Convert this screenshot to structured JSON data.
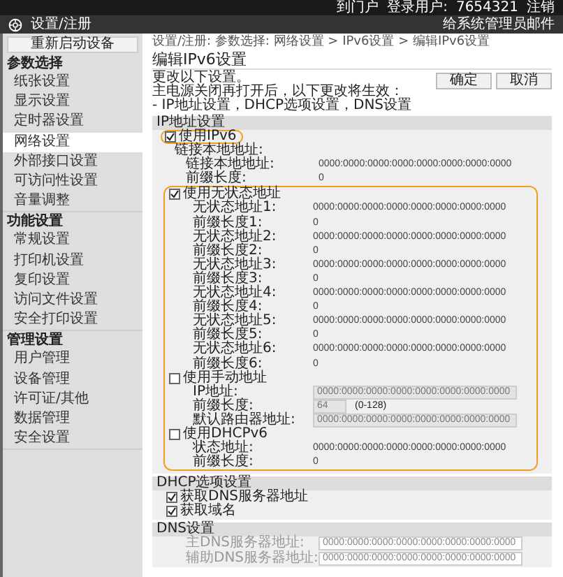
{
  "top_bar": {
    "portal_link": "到门户",
    "user_label": "登录用户:",
    "user_id": "7654321",
    "logout_link": "注销"
  },
  "title_bar": {
    "title": "设置/注册",
    "mail_link": "给系统管理员邮件"
  },
  "sidebar": {
    "restart_button": "重新启动设备",
    "groups": [
      {
        "heading": "参数选择",
        "items": [
          {
            "label": "纸张设置",
            "selected": false
          },
          {
            "label": "显示设置",
            "selected": false
          },
          {
            "label": "定时器设置",
            "selected": false
          },
          {
            "label": "网络设置",
            "selected": true
          },
          {
            "label": "外部接口设置",
            "selected": false
          },
          {
            "label": "可访问性设置",
            "selected": false
          },
          {
            "label": "音量调整",
            "selected": false
          }
        ]
      },
      {
        "heading": "功能设置",
        "items": [
          {
            "label": "常规设置",
            "selected": false
          },
          {
            "label": "打印机设置",
            "selected": false
          },
          {
            "label": "复印设置",
            "selected": false
          },
          {
            "label": "访问文件设置",
            "selected": false
          },
          {
            "label": "安全打印设置",
            "selected": false
          }
        ]
      },
      {
        "heading": "管理设置",
        "items": [
          {
            "label": "用户管理",
            "selected": false
          },
          {
            "label": "设备管理",
            "selected": false
          },
          {
            "label": "许可证/其他",
            "selected": false
          },
          {
            "label": "数据管理",
            "selected": false
          },
          {
            "label": "安全设置",
            "selected": false
          }
        ]
      }
    ]
  },
  "main": {
    "breadcrumb": "设置/注册: 参数选择: 网络设置 > IPv6设置 > 编辑IPv6设置",
    "title": "编辑IPv6设置",
    "notes": [
      "更改以下设置。",
      "主电源关闭再打开后，以下更改将生效：",
      "- IP地址设置，DHCP选项设置，DNS设置"
    ],
    "buttons": [
      "确定",
      "取消"
    ],
    "sections": [
      {
        "heading": "IP地址设置",
        "rows": [
          {
            "kind": "checkbox",
            "label": "使用IPv6",
            "checked": true,
            "highlighted": true
          },
          {
            "kind": "label",
            "label": "链接本地地址:"
          },
          {
            "kind": "value",
            "label": "链接本地地址:",
            "value": "0000:0000:0000:0000:0000:0000:0000:0000"
          },
          {
            "kind": "value",
            "label": "前缀长度:",
            "value": "0"
          },
          {
            "kind": "frame",
            "highlighted": true,
            "rows": [
              {
                "kind": "checkbox",
                "label": "使用无状态地址",
                "checked": true
              },
              {
                "kind": "value",
                "label": "无状态地址1:",
                "value": "0000:0000:0000:0000:0000:0000:0000:0000"
              },
              {
                "kind": "value",
                "label": "前缀长度1:",
                "value": "0"
              },
              {
                "kind": "value",
                "label": "无状态地址2:",
                "value": "0000:0000:0000:0000:0000:0000:0000:0000"
              },
              {
                "kind": "value",
                "label": "前缀长度2:",
                "value": "0"
              },
              {
                "kind": "value",
                "label": "无状态地址3:",
                "value": "0000:0000:0000:0000:0000:0000:0000:0000"
              },
              {
                "kind": "value",
                "label": "前缀长度3:",
                "value": "0"
              },
              {
                "kind": "value",
                "label": "无状态地址4:",
                "value": "0000:0000:0000:0000:0000:0000:0000:0000"
              },
              {
                "kind": "value",
                "label": "前缀长度4:",
                "value": "0"
              },
              {
                "kind": "value",
                "label": "无状态地址5:",
                "value": "0000:0000:0000:0000:0000:0000:0000:0000"
              },
              {
                "kind": "value",
                "label": "前缀长度5:",
                "value": "0"
              },
              {
                "kind": "value",
                "label": "无状态地址6:",
                "value": "0000:0000:0000:0000:0000:0000:0000:0000"
              },
              {
                "kind": "value",
                "label": "前缀长度6:",
                "value": "0"
              },
              {
                "kind": "checkbox",
                "label": "使用手动地址",
                "checked": false
              },
              {
                "kind": "field",
                "label": "IP地址:",
                "value": "0000:0000:0000:0000:0000:0000:0000:0000",
                "disabled": true
              },
              {
                "kind": "field",
                "label": "前缀长度:",
                "value": "64",
                "hint": "(0-128)",
                "disabled": true,
                "short": true
              },
              {
                "kind": "field",
                "label": "默认路由器地址:",
                "value": "0000:0000:0000:0000:0000:0000:0000:0000",
                "disabled": true
              },
              {
                "kind": "checkbox",
                "label": "使用DHCPv6",
                "checked": false
              },
              {
                "kind": "value",
                "label": "状态地址:",
                "value": "0000:0000:0000:0000:0000:0000:0000:0000"
              },
              {
                "kind": "value",
                "label": "前缀长度:",
                "value": "0"
              }
            ]
          }
        ]
      },
      {
        "heading": "DHCP选项设置",
        "rows": [
          {
            "kind": "checkbox",
            "label": "获取DNS服务器地址",
            "checked": true
          },
          {
            "kind": "checkbox",
            "label": "获取域名",
            "checked": true
          }
        ]
      },
      {
        "heading": "DNS设置",
        "rows": [
          {
            "kind": "field",
            "label": "主DNS服务器地址:",
            "value": "0000:0000:0000:0000:0000:0000:0000:0000",
            "disabled": true
          },
          {
            "kind": "field",
            "label": "辅助DNS服务器地址:",
            "value": "0000:0000:0000:0000:0000:0000:0000:0000",
            "disabled": true
          }
        ]
      }
    ]
  }
}
